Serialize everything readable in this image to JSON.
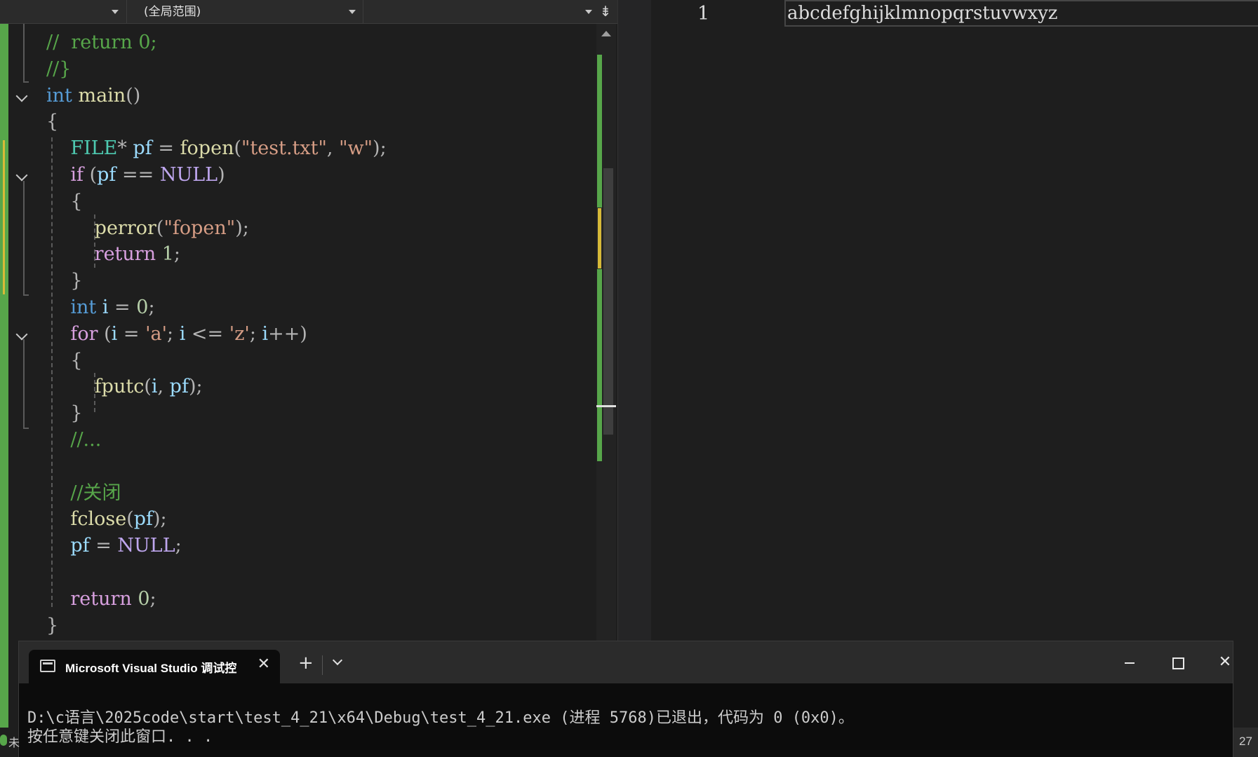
{
  "editor": {
    "nav": {
      "scope_dropdown": "(全局范围)"
    },
    "code_lines": [
      {
        "parts": [
          [
            "cm",
            "//  return 0;"
          ]
        ]
      },
      {
        "parts": [
          [
            "cm",
            "//}"
          ]
        ]
      },
      {
        "parts": [
          [
            "kw",
            "int"
          ],
          [
            "",
            " "
          ],
          [
            "fn",
            "main"
          ],
          [
            "pn",
            "()"
          ]
        ]
      },
      {
        "parts": [
          [
            "pn",
            "{"
          ]
        ]
      },
      {
        "parts": [
          [
            "",
            "    "
          ],
          [
            "ty",
            "FILE"
          ],
          [
            "pn",
            "* "
          ],
          [
            "var",
            "pf"
          ],
          [
            "pn",
            " = "
          ],
          [
            "fn",
            "fopen"
          ],
          [
            "pn",
            "("
          ],
          [
            "str",
            "\"test.txt\""
          ],
          [
            "pn",
            ", "
          ],
          [
            "str",
            "\"w\""
          ],
          [
            "pn",
            ");"
          ]
        ]
      },
      {
        "parts": [
          [
            "",
            "    "
          ],
          [
            "kwc",
            "if"
          ],
          [
            "pn",
            " ("
          ],
          [
            "var",
            "pf"
          ],
          [
            "pn",
            " == "
          ],
          [
            "mac",
            "NULL"
          ],
          [
            "pn",
            ")"
          ]
        ]
      },
      {
        "parts": [
          [
            "",
            "    "
          ],
          [
            "pn",
            "{"
          ]
        ]
      },
      {
        "parts": [
          [
            "",
            "        "
          ],
          [
            "fn",
            "perror"
          ],
          [
            "pn",
            "("
          ],
          [
            "str",
            "\"fopen\""
          ],
          [
            "pn",
            ");"
          ]
        ]
      },
      {
        "parts": [
          [
            "",
            "        "
          ],
          [
            "kwc",
            "return"
          ],
          [
            "",
            " "
          ],
          [
            "num",
            "1"
          ],
          [
            "pn",
            ";"
          ]
        ]
      },
      {
        "parts": [
          [
            "",
            "    "
          ],
          [
            "pn",
            "}"
          ]
        ]
      },
      {
        "parts": [
          [
            "",
            "    "
          ],
          [
            "kw",
            "int"
          ],
          [
            "",
            " "
          ],
          [
            "var",
            "i"
          ],
          [
            "pn",
            " = "
          ],
          [
            "num",
            "0"
          ],
          [
            "pn",
            ";"
          ]
        ]
      },
      {
        "parts": [
          [
            "",
            "    "
          ],
          [
            "kwc",
            "for"
          ],
          [
            "pn",
            " ("
          ],
          [
            "var",
            "i"
          ],
          [
            "pn",
            " = "
          ],
          [
            "str",
            "'a'"
          ],
          [
            "pn",
            "; "
          ],
          [
            "var",
            "i"
          ],
          [
            "pn",
            " <= "
          ],
          [
            "str",
            "'z'"
          ],
          [
            "pn",
            "; "
          ],
          [
            "var",
            "i"
          ],
          [
            "pn",
            "++)"
          ]
        ]
      },
      {
        "parts": [
          [
            "",
            "    "
          ],
          [
            "pn",
            "{"
          ]
        ]
      },
      {
        "parts": [
          [
            "",
            "        "
          ],
          [
            "fn",
            "fputc"
          ],
          [
            "pn",
            "("
          ],
          [
            "var",
            "i"
          ],
          [
            "pn",
            ", "
          ],
          [
            "var",
            "pf"
          ],
          [
            "pn",
            ");"
          ]
        ]
      },
      {
        "parts": [
          [
            "",
            "    "
          ],
          [
            "pn",
            "}"
          ]
        ]
      },
      {
        "parts": [
          [
            "",
            "    "
          ],
          [
            "cm",
            "//..."
          ]
        ]
      },
      {
        "parts": [
          [
            "",
            ""
          ]
        ]
      },
      {
        "parts": [
          [
            "",
            "    "
          ],
          [
            "cm",
            "//关闭"
          ]
        ]
      },
      {
        "parts": [
          [
            "",
            "    "
          ],
          [
            "fn",
            "fclose"
          ],
          [
            "pn",
            "("
          ],
          [
            "var",
            "pf"
          ],
          [
            "pn",
            ");"
          ]
        ]
      },
      {
        "parts": [
          [
            "",
            "    "
          ],
          [
            "var",
            "pf"
          ],
          [
            "pn",
            " = "
          ],
          [
            "mac",
            "NULL"
          ],
          [
            "pn",
            ";"
          ]
        ]
      },
      {
        "parts": [
          [
            "",
            ""
          ]
        ]
      },
      {
        "parts": [
          [
            "",
            "    "
          ],
          [
            "kwc",
            "return"
          ],
          [
            "",
            " "
          ],
          [
            "num",
            "0"
          ],
          [
            "pn",
            ";"
          ]
        ]
      },
      {
        "parts": [
          [
            "pn",
            "}"
          ]
        ]
      }
    ]
  },
  "textfile": {
    "line_number": "1",
    "content": "abcdefghijklmnopqrstuvwxyz"
  },
  "terminal": {
    "tab_title": "Microsoft Visual Studio 调试控",
    "tab_close": "✕",
    "new_tab": "+",
    "output_line1": "D:\\c语言\\2025code\\start\\test_4_21\\x64\\Debug\\test_4_21.exe (进程 5768)已退出，代码为 0 (0x0)。",
    "output_line2": "按任意键关闭此窗口. . .",
    "close_symbol": "✕"
  },
  "status": {
    "left_char": "未",
    "right_text": "27"
  },
  "icons": [
    "chevron-down-icon",
    "split-view-icon",
    "terminal-app-icon",
    "close-icon",
    "plus-icon",
    "minimize-icon",
    "maximize-icon"
  ]
}
